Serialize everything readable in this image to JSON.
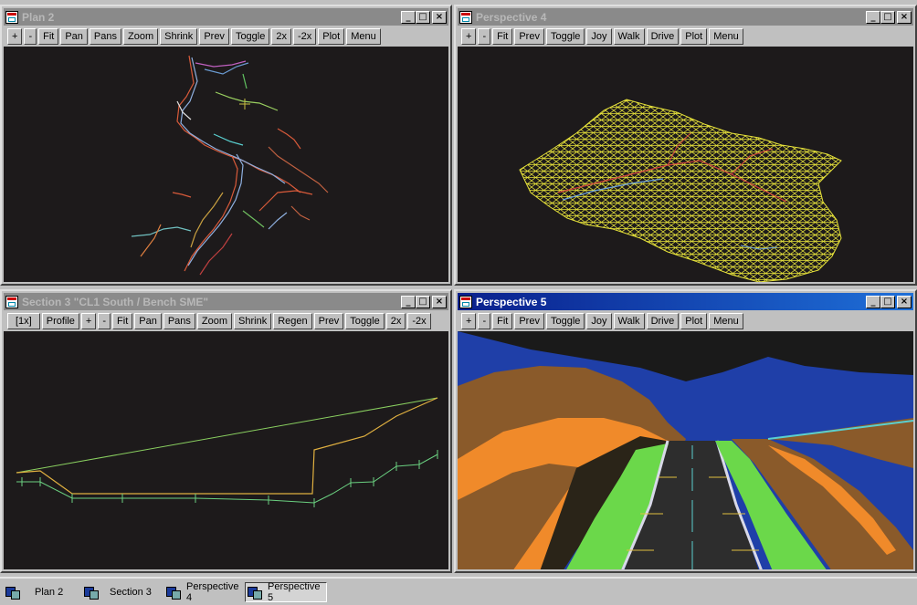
{
  "windows": {
    "plan": {
      "title": "Plan 2",
      "toolbar": [
        "+",
        "-",
        "Fit",
        "Pan",
        "Pans",
        "Zoom",
        "Shrink",
        "Prev",
        "Toggle",
        "2x",
        "-2x",
        "Plot",
        "Menu"
      ]
    },
    "persp4": {
      "title": "Perspective 4",
      "toolbar": [
        "+",
        "-",
        "Fit",
        "Prev",
        "Toggle",
        "Joy",
        "Walk",
        "Drive",
        "Plot",
        "Menu"
      ]
    },
    "section": {
      "title": "Section 3 \"CL1 South / Bench SME\"",
      "toolbar": [
        "[1x]",
        "Profile",
        "+",
        "-",
        "Fit",
        "Pan",
        "Pans",
        "Zoom",
        "Shrink",
        "Regen",
        "Prev",
        "Toggle",
        "2x",
        "-2x"
      ]
    },
    "persp5": {
      "title": "Perspective 5",
      "toolbar": [
        "+",
        "-",
        "Fit",
        "Prev",
        "Toggle",
        "Joy",
        "Walk",
        "Drive",
        "Plot",
        "Menu"
      ]
    }
  },
  "caption_buttons": {
    "minimize": "_",
    "maximize": "□",
    "close": "×"
  },
  "taskbar": {
    "items": [
      {
        "label": "Plan 2",
        "active": false
      },
      {
        "label": "Section 3",
        "active": false
      },
      {
        "label": "Perspective 4",
        "active": false
      },
      {
        "label": "Perspective 5",
        "active": true
      }
    ]
  },
  "colors": {
    "active_title": "#0a1f8c",
    "inactive_title": "#8a8a8a",
    "viewport_bg": "#1d1a1b",
    "terrain_mesh": "#e6e23a",
    "road_green": "#6bd84a",
    "sky_blue": "#1f3fa8"
  }
}
